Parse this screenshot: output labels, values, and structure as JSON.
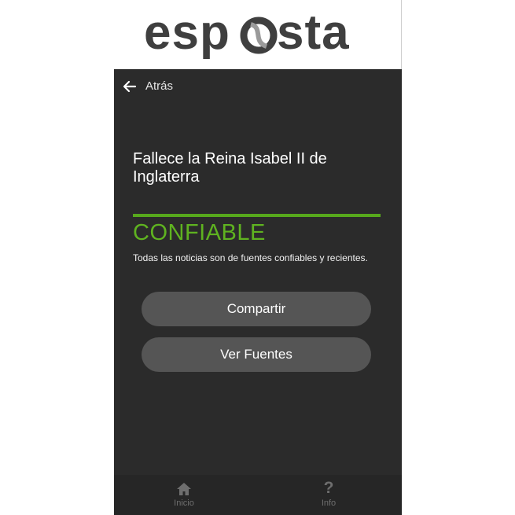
{
  "header": {
    "logo_text": "esposta",
    "logo_icon": "swirl-o-icon"
  },
  "topbar": {
    "back_label": "Atrás",
    "back_icon": "arrow-left-icon"
  },
  "article": {
    "title": "Fallece la Reina Isabel II de Inglaterra",
    "verdict": "CONFIABLE",
    "verdict_color": "#5fb320",
    "description": "Todas las noticias son de fuentes confiables y recientes."
  },
  "actions": {
    "share_label": "Compartir",
    "sources_label": "Ver Fuentes"
  },
  "bottom_nav": {
    "items": [
      {
        "label": "Inicio",
        "icon": "home-icon"
      },
      {
        "label": "Info",
        "icon": "question-icon"
      }
    ]
  },
  "colors": {
    "background": "#2b2b2b",
    "accent": "#57a81c",
    "button": "#555555"
  }
}
